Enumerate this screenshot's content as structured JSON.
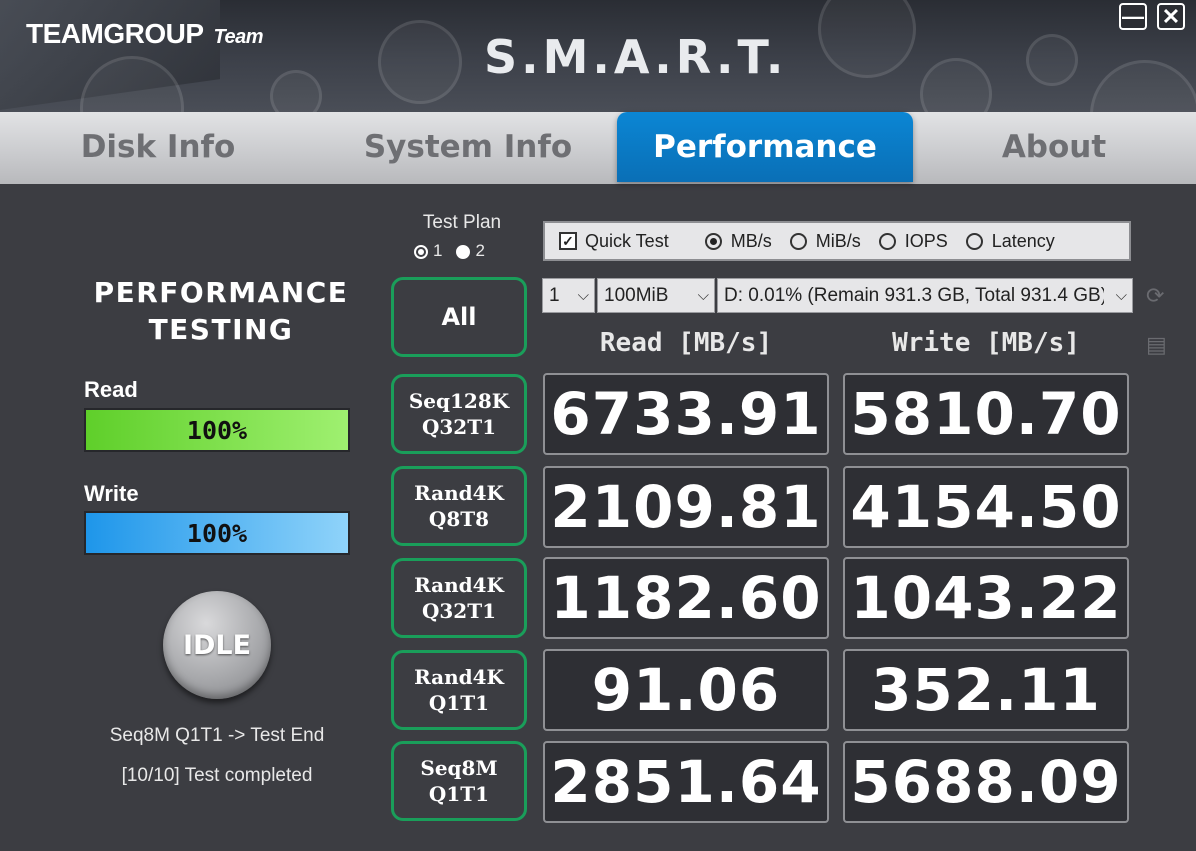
{
  "app": {
    "brand": "TEAMGROUP",
    "brand_sub": "Team",
    "title": "S.M.A.R.T.",
    "minimize_glyph": "—",
    "close_glyph": "✕"
  },
  "tabs": [
    {
      "label": "Disk Info",
      "active": false
    },
    {
      "label": "System Info",
      "active": false
    },
    {
      "label": "Performance",
      "active": true
    },
    {
      "label": "About",
      "active": false
    }
  ],
  "left": {
    "title_line1": "PERFORMANCE",
    "title_line2": "TESTING",
    "read_label": "Read",
    "read_progress": "100%",
    "write_label": "Write",
    "write_progress": "100%",
    "idle_label": "IDLE",
    "status_line1": "Seq8M Q1T1 -> Test End",
    "status_line2": "[10/10] Test completed"
  },
  "test_plan": {
    "label": "Test Plan",
    "options": [
      "1",
      "2"
    ],
    "selected": "2"
  },
  "options_bar": {
    "quick_test_label": "Quick Test",
    "quick_test_checked": true,
    "units": [
      "MB/s",
      "MiB/s",
      "IOPS",
      "Latency"
    ],
    "selected_unit": "MB/s"
  },
  "selects": {
    "count": "1",
    "size": "100MiB",
    "drive": "D: 0.01% (Remain 931.3 GB, Total 931.4 GB)"
  },
  "columns": {
    "read": "Read [MB/s]",
    "write": "Write [MB/s]"
  },
  "all_button": "All",
  "tests": [
    {
      "line1": "Seq128K",
      "line2": "Q32T1",
      "read": "6733.91",
      "write": "5810.70"
    },
    {
      "line1": "Rand4K",
      "line2": "Q8T8",
      "read": "2109.81",
      "write": "4154.50"
    },
    {
      "line1": "Rand4K",
      "line2": "Q32T1",
      "read": "1182.60",
      "write": "1043.22"
    },
    {
      "line1": "Rand4K",
      "line2": "Q1T1",
      "read": "91.06",
      "write": "352.11"
    },
    {
      "line1": "Seq8M",
      "line2": "Q1T1",
      "read": "2851.64",
      "write": "5688.09"
    }
  ],
  "colors": {
    "accent_tab": "#0a7cc7",
    "read_bar": "#8ee65a",
    "write_bar": "#4fb3f0",
    "test_border": "#1a9e5a"
  }
}
